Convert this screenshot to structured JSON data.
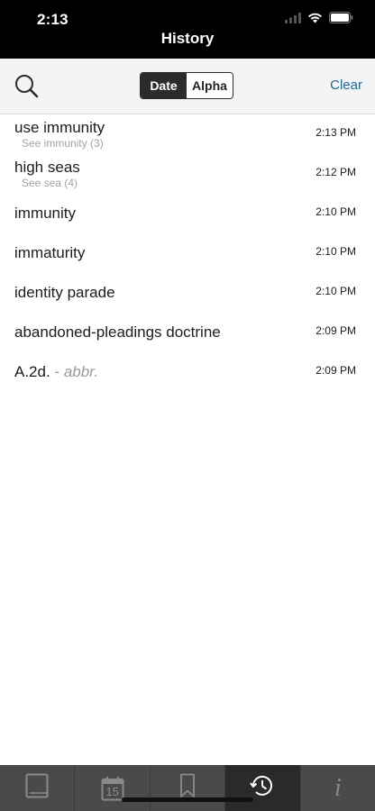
{
  "status_bar": {
    "time": "2:13"
  },
  "nav": {
    "title": "History"
  },
  "toolbar": {
    "segments": [
      "Date",
      "Alpha"
    ],
    "selected_segment": "Date",
    "clear_label": "Clear"
  },
  "history": [
    {
      "term": "use immunity",
      "sub": "See immunity (3)",
      "time": "2:13 PM"
    },
    {
      "term": "high seas",
      "sub": "See sea (4)",
      "time": "2:12 PM"
    },
    {
      "term": "immunity",
      "time": "2:10 PM"
    },
    {
      "term": "immaturity",
      "time": "2:10 PM"
    },
    {
      "term": "identity parade",
      "time": "2:10 PM"
    },
    {
      "term": "abandoned-pleadings doctrine",
      "time": "2:09 PM"
    },
    {
      "term": "A.2d.",
      "abbr_dash": " - ",
      "abbr": "abbr.",
      "time": "2:09 PM"
    }
  ],
  "tabbar": {
    "calendar_day": "15",
    "info_glyph": "i",
    "selected_tab": "history"
  },
  "colors": {
    "topbar": "#000000",
    "toolbar": "#f4f4f4",
    "accent_link": "#1f6b9a",
    "tabbar": "#4a4a4a",
    "tabbar_selected": "#2a2a2a"
  }
}
